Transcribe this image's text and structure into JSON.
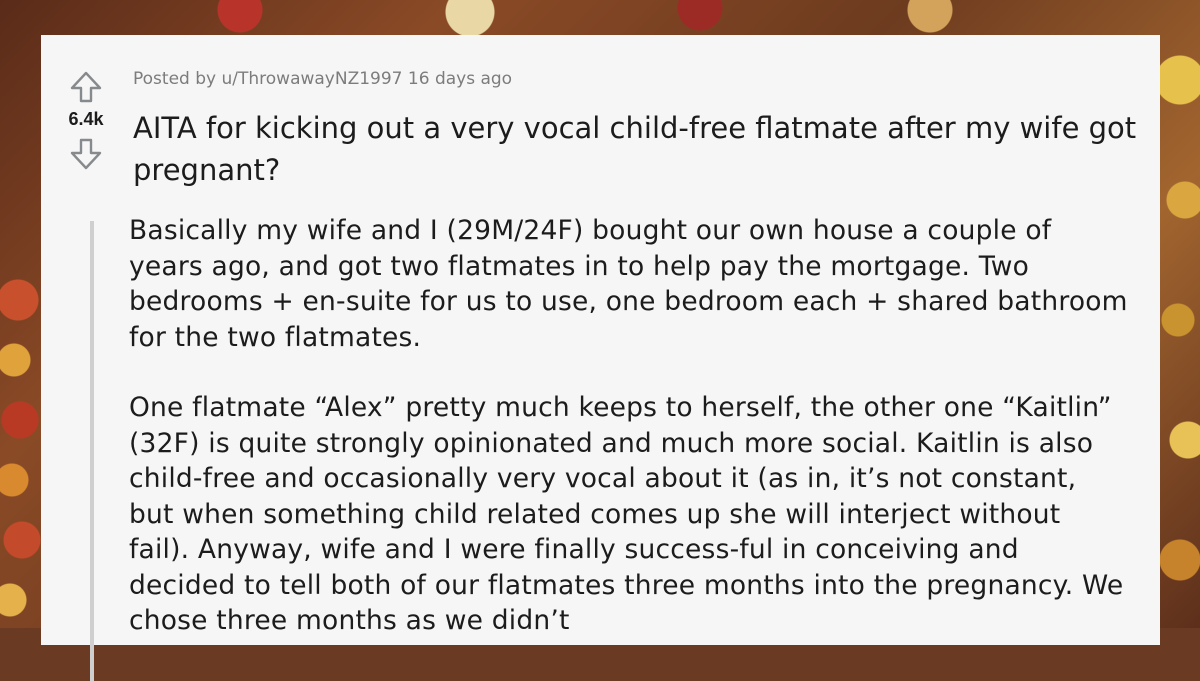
{
  "post": {
    "score": "6.4k",
    "meta": {
      "prefix": "Posted by",
      "username": "u/ThrowawayNZ1997",
      "time": "16 days ago"
    },
    "title": "AITA for kicking out a very vocal child-free flatmate after my wife got pregnant?",
    "paragraphs": [
      "Basically my wife and I (29M/24F) bought our own house a couple of years ago, and got two flatmates in to help pay the mortgage. Two bedrooms + en-suite for us to use, one bedroom each + shared bathroom for the two flatmates.",
      "One flatmate “Alex” pretty much keeps to herself, the other one “Kaitlin” (32F) is quite strongly opinionated and much more social. Kaitlin is also child-free and occasionally very vocal about it (as in, it’s not constant, but when something child related comes up she will interject without fail). Anyway, wife and I were finally success-ful in conceiving and decided to tell both of our flatmates three months into the pregnancy. We chose three months as we didn’t"
    ]
  },
  "icons": {
    "upvote": "arrow-up-outline-icon",
    "downvote": "arrow-down-outline-icon"
  },
  "colors": {
    "card_bg": "#f6f6f6",
    "text": "#1c1c1c",
    "meta": "#7c7c7c",
    "quote_bar": "#cfcfcf"
  }
}
